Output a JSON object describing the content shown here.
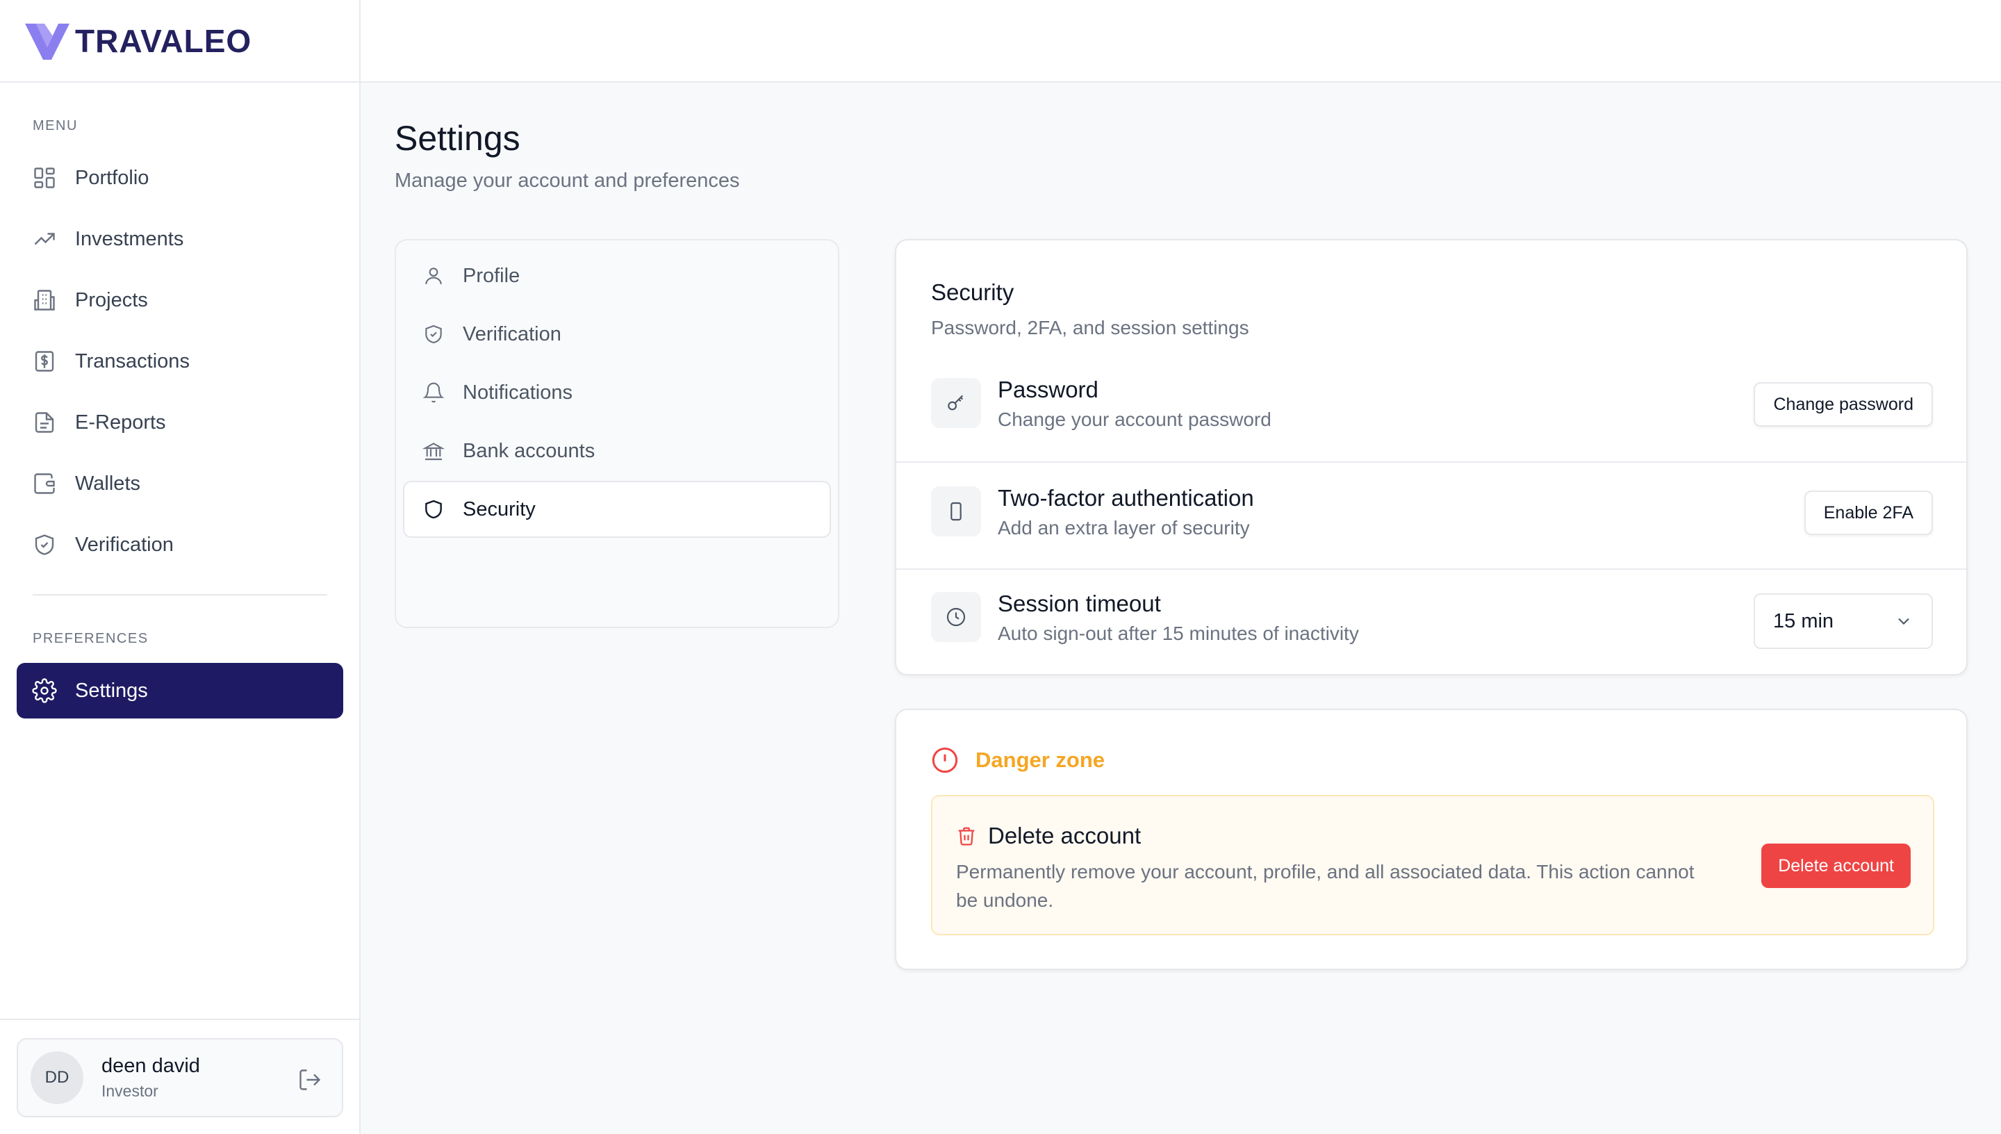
{
  "brand": {
    "name": "TRAVALEO"
  },
  "sidebar": {
    "menu_label": "MENU",
    "items": [
      {
        "label": "Portfolio",
        "icon": "grid-icon"
      },
      {
        "label": "Investments",
        "icon": "trending-up-icon"
      },
      {
        "label": "Projects",
        "icon": "building-icon"
      },
      {
        "label": "Transactions",
        "icon": "dollar-receipt-icon"
      },
      {
        "label": "E-Reports",
        "icon": "document-icon"
      },
      {
        "label": "Wallets",
        "icon": "wallet-icon"
      },
      {
        "label": "Verification",
        "icon": "shield-check-icon"
      }
    ],
    "preferences_label": "PREFERENCES",
    "pref_items": [
      {
        "label": "Settings",
        "icon": "gear-icon",
        "active": true
      }
    ]
  },
  "user": {
    "initials": "DD",
    "name": "deen david",
    "role": "Investor"
  },
  "page": {
    "title": "Settings",
    "subtitle": "Manage your account and preferences"
  },
  "settings_nav": [
    {
      "label": "Profile",
      "icon": "user-icon"
    },
    {
      "label": "Verification",
      "icon": "shield-check-icon"
    },
    {
      "label": "Notifications",
      "icon": "bell-icon"
    },
    {
      "label": "Bank accounts",
      "icon": "bank-icon"
    },
    {
      "label": "Security",
      "icon": "shield-icon",
      "active": true
    }
  ],
  "security": {
    "title": "Security",
    "subtitle": "Password, 2FA, and session settings",
    "password": {
      "title": "Password",
      "subtitle": "Change your account password",
      "button": "Change password"
    },
    "twofa": {
      "title": "Two-factor authentication",
      "subtitle": "Add an extra layer of security",
      "button": "Enable 2FA"
    },
    "session": {
      "title": "Session timeout",
      "subtitle": "Auto sign-out after 15 minutes of inactivity",
      "value": "15 min"
    }
  },
  "danger": {
    "title": "Danger zone",
    "delete_title": "Delete account",
    "delete_desc": "Permanently remove your account, profile, and all associated data. This action cannot be undone.",
    "delete_button": "Delete account"
  },
  "colors": {
    "accent": "#1e1a63",
    "brand_text": "#23215f",
    "brand_logo": "#8b7ff0",
    "danger": "#ef4444",
    "warning": "#f5a623"
  }
}
